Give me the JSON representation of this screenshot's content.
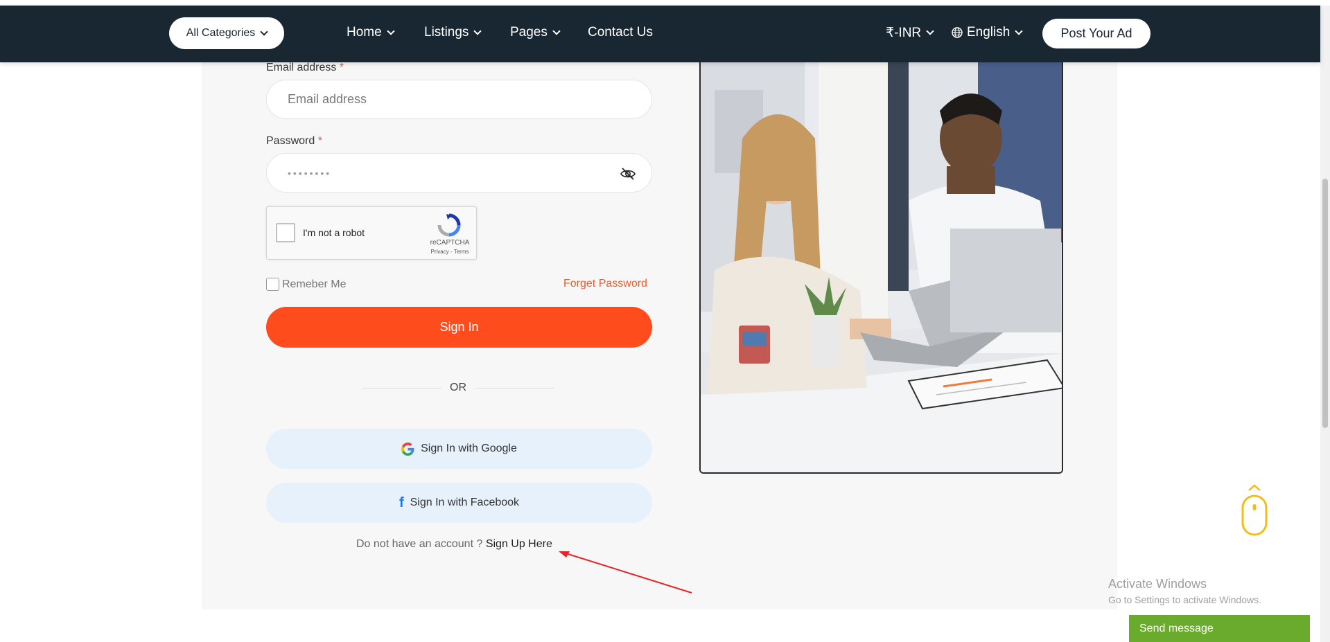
{
  "header": {
    "categories_label": "All Categories",
    "nav": [
      {
        "label": "Home"
      },
      {
        "label": "Listings"
      },
      {
        "label": "Pages"
      },
      {
        "label": "Contact Us"
      }
    ],
    "currency_label": "₹-INR",
    "language_label": "English",
    "post_ad_label": "Post Your Ad",
    "background_color": "#182732"
  },
  "form": {
    "email_label": "Email address",
    "email_placeholder": "Email address",
    "password_label": "Password",
    "password_value": "••••••••",
    "required_mark": "*",
    "captcha": {
      "label": "I'm not a robot",
      "brand": "reCAPTCHA",
      "links": "Privacy - Terms"
    },
    "remember_label": "Remeber Me",
    "forget_label": "Forget Password",
    "signin_label": "Sign In",
    "or_label": "OR",
    "google_label": "Sign In with Google",
    "facebook_label": "Sign In with Facebook",
    "no_account_text": "Do not have an account ?",
    "signup_label": "Sign Up Here",
    "accent_color": "#fe4c1c"
  },
  "overlay": {
    "activate_title": "Activate Windows",
    "activate_sub": "Go to Settings to activate Windows.",
    "send_message_label": "Send message"
  },
  "icons": {
    "dropdown": "chevron-down-icon",
    "globe": "globe-icon",
    "eye": "eye-slash-icon",
    "google": "google-icon",
    "facebook": "facebook-icon",
    "scroll_mouse": "mouse-scroll-icon"
  }
}
